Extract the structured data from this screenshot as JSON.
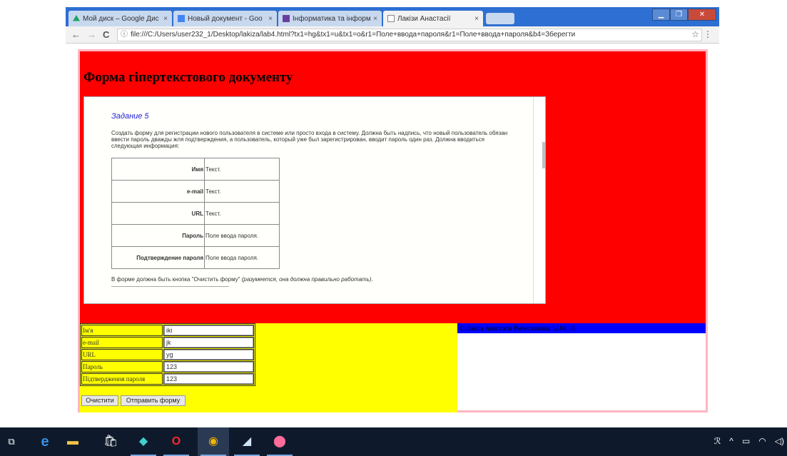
{
  "browser": {
    "tabs": [
      {
        "label": "Мой диск – Google Дис",
        "favicon_color": "#1fa463",
        "active": false
      },
      {
        "label": "Новый документ - Goo",
        "favicon_color": "#4285f4",
        "active": false
      },
      {
        "label": "Інформатика та інформ",
        "favicon_color": "#6a3ea1",
        "active": false
      },
      {
        "label": "Лакізи Анастасії",
        "favicon_color": "#888888",
        "active": true
      }
    ],
    "tab_close": "×",
    "address": "file:///C:/Users/user232_1/Desktop/lakiza/lab4.html?tx1=hg&tx1=u&tx1=o&r1=Поле+ввода+пароля&r1=Поле+ввода+пароля&b4=Зберегти",
    "nav": {
      "back": "←",
      "forward": "→",
      "reload": "C",
      "info": "ⓘ",
      "star": "☆",
      "menu": "⋮"
    },
    "window_controls": {
      "min": "▁",
      "max": "❐",
      "close": "✕"
    }
  },
  "page": {
    "title": "Форма гіпертекстового документу",
    "task": {
      "heading": "Задание 5",
      "description": "Создать форму для регистрации нового пользователя в системе или просто входа в систему. Должна быть надпись, что новый пользователь обязан ввести пароль дважды жля подтверждения, а пользователь, который уже был зарегистрирован, вводит пароль один раз. Должна вводиться следующая информация:",
      "rows": [
        {
          "field": "Имя",
          "type": "Текст."
        },
        {
          "field": "e-mail",
          "type": "Текст."
        },
        {
          "field": "URL",
          "type": "Текст."
        },
        {
          "field": "Пароль",
          "type": "Поле ввода пароля."
        },
        {
          "field": "Подтверждение пароля",
          "type": "Поле ввода пароля."
        }
      ],
      "note": "В форме должна быть кнопка \"Очистить форму\"",
      "note_italic": "(разумеется, она должна правильно работать)."
    },
    "footer_text": "© Лакіза Анастасія Вячеславівна 12.04.18",
    "form": {
      "rows": [
        {
          "label": "Ім'я",
          "value": "iki"
        },
        {
          "label": "e-mail",
          "value": "jk"
        },
        {
          "label": "URL",
          "value": "yg"
        },
        {
          "label": "Пароль",
          "value": "123"
        },
        {
          "label": "Підтвердження пароля",
          "value": "123"
        }
      ],
      "clear_button": "Очистити",
      "submit_button": "Отправить форму"
    },
    "colors": {
      "header_bg": "#ff0000",
      "form_bg": "#ffff00",
      "footer_bg": "#0000ff",
      "border": "#ffb6c1"
    }
  },
  "taskbar": {
    "icons": [
      "task-view-icon",
      "edge-icon",
      "file-explorer-icon",
      "store-icon",
      "app-icon",
      "opera-icon",
      "chrome-icon",
      "photos-icon",
      "paint-icon"
    ],
    "glyphs": {
      "task_view": "⧉",
      "edge": "e",
      "explorer": "▬",
      "store": "🛍",
      "app": "◆",
      "opera": "O",
      "chrome": "◉",
      "photos": "◢",
      "paint": "⬤"
    },
    "tray": {
      "people": "ℛ",
      "chevron": "^",
      "battery": "▭",
      "wifi": "◠",
      "volume": "◁)"
    }
  }
}
